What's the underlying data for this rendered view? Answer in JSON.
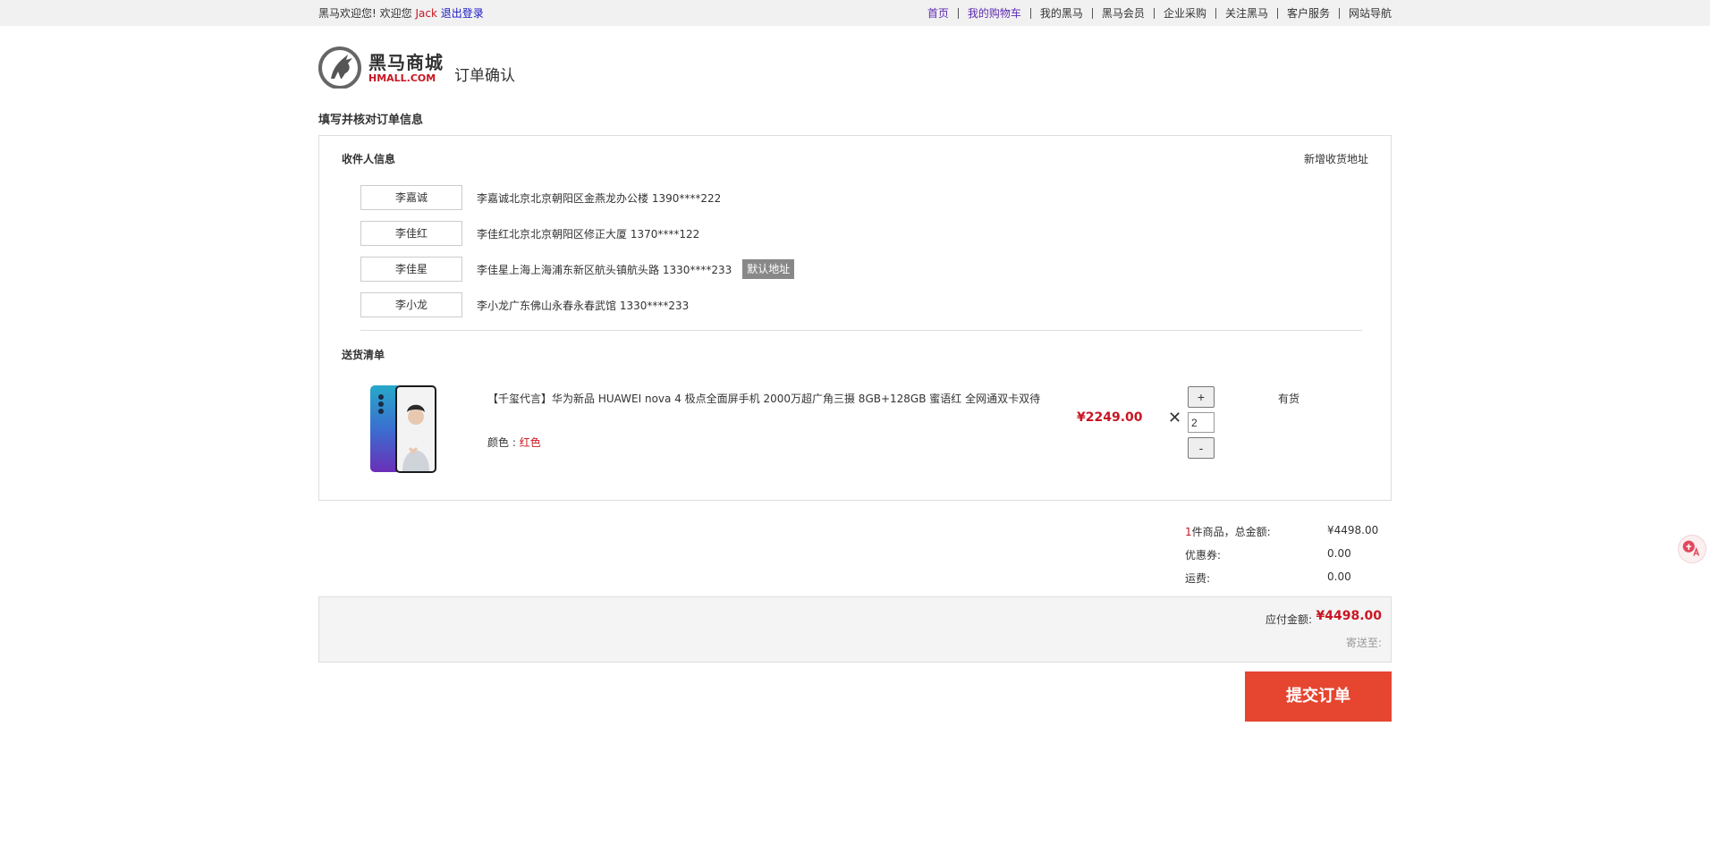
{
  "topbar": {
    "welcome": "黑马欢迎您!  欢迎您 ",
    "username": "Jack",
    "logout": "退出登录",
    "nav": [
      "首页",
      "我的购物车",
      "我的黑马",
      "黑马会员",
      "企业采购",
      "关注黑马",
      "客户服务",
      "网站导航"
    ]
  },
  "header": {
    "logo_cn": "黑马商城",
    "logo_en": "HMALL.COM",
    "page_title": "订单确认"
  },
  "section_heading": "填写并核对订单信息",
  "receiver": {
    "heading": "收件人信息",
    "new_address": "新增收货地址",
    "addresses": [
      {
        "name": "李嘉诚",
        "detail": "李嘉诚北京北京朝阳区金燕龙办公楼 1390****222"
      },
      {
        "name": "李佳红",
        "detail": "李佳红北京北京朝阳区修正大厦 1370****122"
      },
      {
        "name": "李佳星",
        "detail": "李佳星上海上海浦东新区航头镇航头路 1330****233",
        "tag": "默认地址"
      },
      {
        "name": "李小龙",
        "detail": "李小龙广东佛山永春永春武馆 1330****233"
      }
    ]
  },
  "delivery": {
    "heading": "送货清单",
    "product": {
      "name": "【千玺代言】华为新品 HUAWEI nova 4 极点全面屏手机 2000万超广角三摄 8GB+128GB 蜜语红 全网通双卡双待",
      "color_label": "颜色 : ",
      "color_value": "红色",
      "price": "¥2249.00",
      "times": "✕",
      "qty_plus": "+",
      "quantity": "2",
      "qty_minus": "-",
      "stock": "有货"
    }
  },
  "summary": {
    "count": "1",
    "count_suffix": "件商品，总金额:",
    "total": "¥4498.00",
    "coupon_label": "优惠券:",
    "coupon": "0.00",
    "shipping_label": "运费:",
    "shipping": "0.00"
  },
  "payment": {
    "payable_label": "应付金额:",
    "payable": "¥4498.00",
    "ship_to": "寄送至:"
  },
  "submit_label": "提交订单",
  "colors": {
    "accent": "#c81623",
    "submit": "#e64530",
    "topbar": "#f1f1f1"
  },
  "icons": {
    "logo": "horse-logo-icon",
    "translate": "translate-icon"
  }
}
